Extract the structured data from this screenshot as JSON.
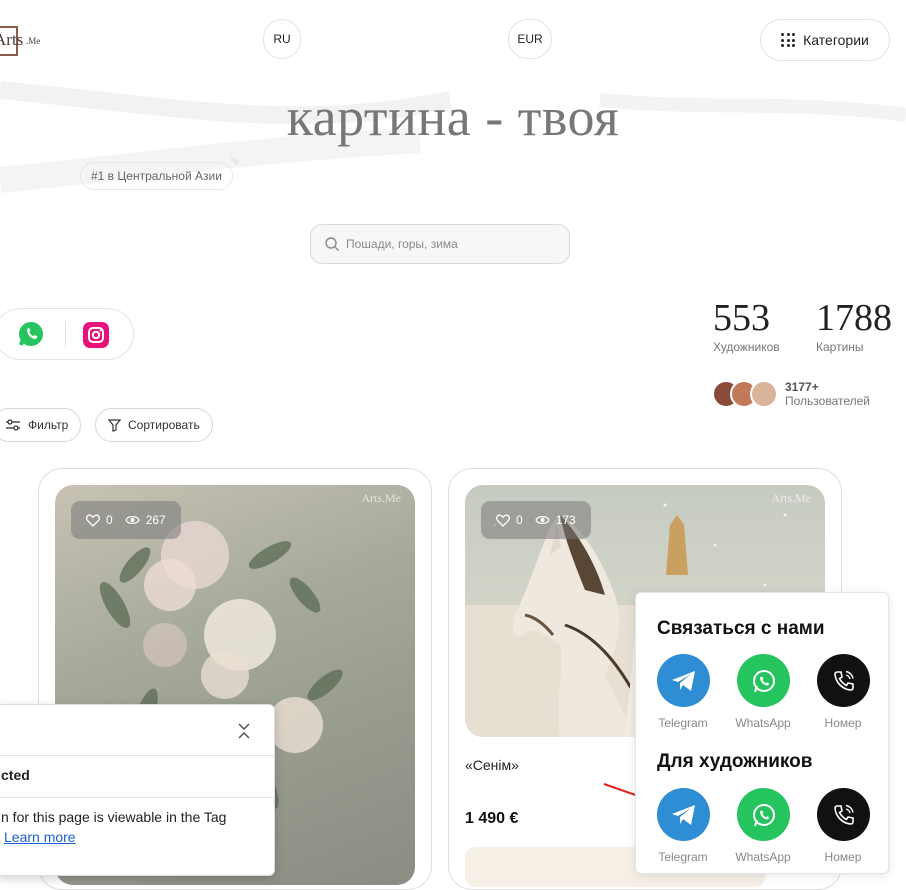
{
  "header": {
    "logo_text": "Arts",
    "logo_suffix": ".Me",
    "language": "RU",
    "currency": "EUR",
    "categories_label": "Категории"
  },
  "hero": {
    "title": "картина - твоя",
    "badge": "#1 в Центральной Азии",
    "search_placeholder": "Пошади, горы, зима"
  },
  "stats": {
    "artists_count": "553",
    "artists_label": "Художников",
    "paintings_count": "1788",
    "paintings_label": "Картины",
    "users_count": "3177+",
    "users_label": "Пользователей"
  },
  "toolbar": {
    "filter_label": "Фильтр",
    "sort_label": "Сортировать"
  },
  "cards": [
    {
      "likes": "0",
      "views": "267",
      "watermark": "Arts.Me"
    },
    {
      "likes": "0",
      "views": "173",
      "watermark": "Arts.Me",
      "title": "«Сенім»",
      "price": "1 490 €"
    }
  ],
  "contact_popup": {
    "heading_contact": "Связаться с нами",
    "heading_artists": "Для художников",
    "channels": [
      "Telegram",
      "WhatsApp",
      "Номер"
    ]
  },
  "tag_panel": {
    "status_text": "cted",
    "body_text": "n for this page is viewable in the Tag",
    "link_text": "Learn more"
  },
  "colors": {
    "telegram": "#2f8dd3",
    "whatsapp": "#25c45f",
    "phone": "#111111",
    "instagram": "#e8117a"
  }
}
